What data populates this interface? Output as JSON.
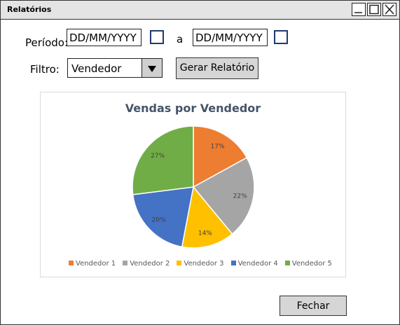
{
  "window": {
    "title": "Relatórios",
    "controls": [
      "minimize-icon",
      "maximize-icon",
      "close-icon"
    ]
  },
  "filters": {
    "period_label": "Período:",
    "date_from": {
      "value": "DD/MM/YYYY"
    },
    "separator": "a",
    "date_to": {
      "value": "DD/MM/YYYY"
    },
    "filter_label": "Filtro:",
    "filter_value": "Vendedor",
    "generate_button": "Gerar Relatório"
  },
  "chart_data": {
    "type": "pie",
    "title": "Vendas por Vendedor",
    "categories": [
      "Vendedor 1",
      "Vendedor 2",
      "Vendedor 3",
      "Vendedor 4",
      "Vendedor 5"
    ],
    "values": [
      17,
      22,
      14,
      20,
      27
    ],
    "labels": [
      "17%",
      "22%",
      "14%",
      "20%",
      "27%"
    ],
    "colors": [
      "#ed7d31",
      "#a5a5a5",
      "#ffc000",
      "#4472c4",
      "#70ad47"
    ],
    "legend_position": "bottom"
  },
  "footer": {
    "close_button": "Fechar"
  }
}
